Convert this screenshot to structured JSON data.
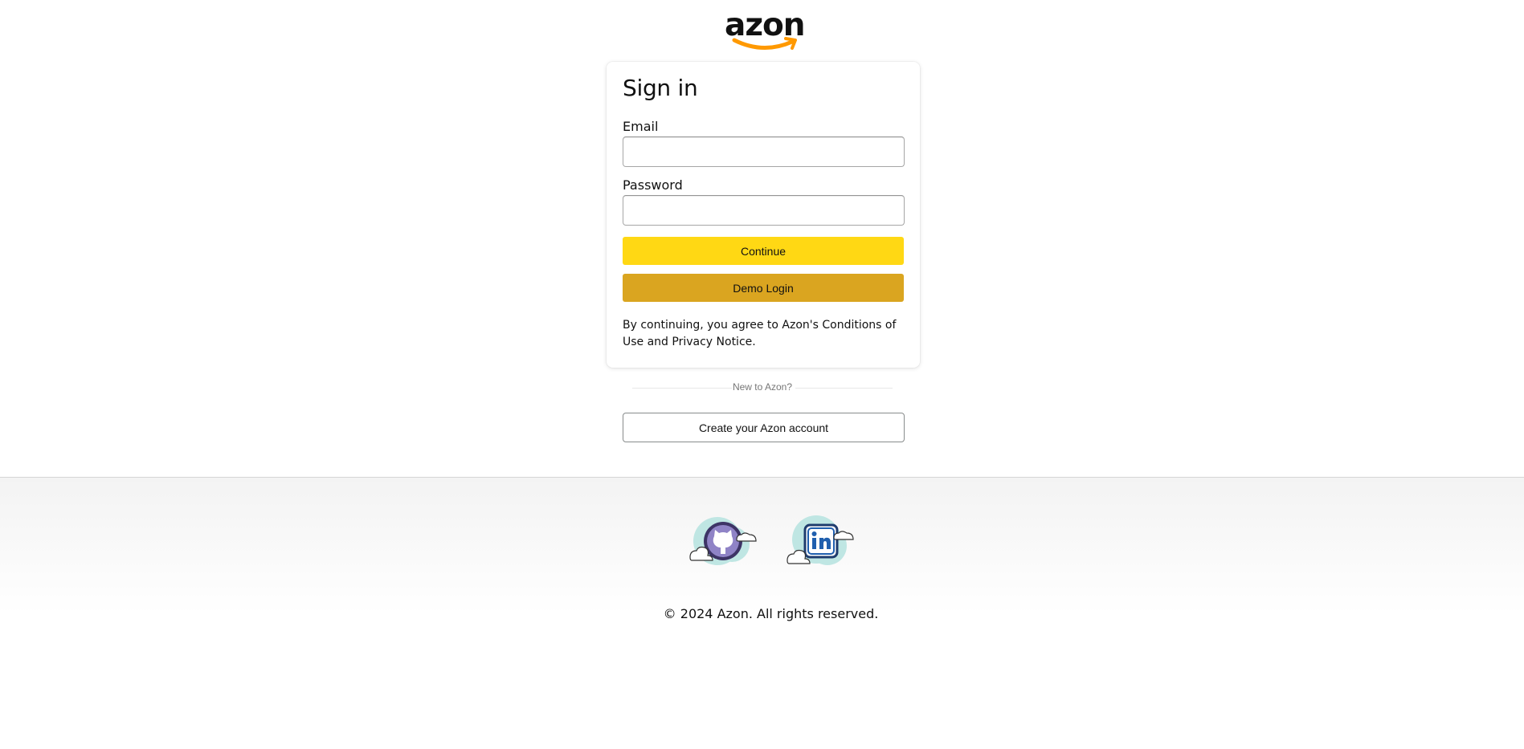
{
  "logo": {
    "text": "azon"
  },
  "signin": {
    "title": "Sign in",
    "email_label": "Email",
    "email_value": "",
    "password_label": "Password",
    "password_value": "",
    "continue_label": "Continue",
    "demo_label": "Demo Login",
    "legal_text": "By continuing, you agree to Azon's Conditions of Use and Privacy Notice."
  },
  "new_customer": {
    "divider_text": "New to Azon?",
    "create_label": "Create your Azon account"
  },
  "footer": {
    "social": [
      {
        "icon": "github-icon"
      },
      {
        "icon": "linkedin-icon"
      }
    ],
    "copyright": "© 2024 Azon. All rights reserved."
  },
  "colors": {
    "continue_button": "#ffd814",
    "demo_button": "#daa520",
    "logo_smile": "#ff9900"
  }
}
